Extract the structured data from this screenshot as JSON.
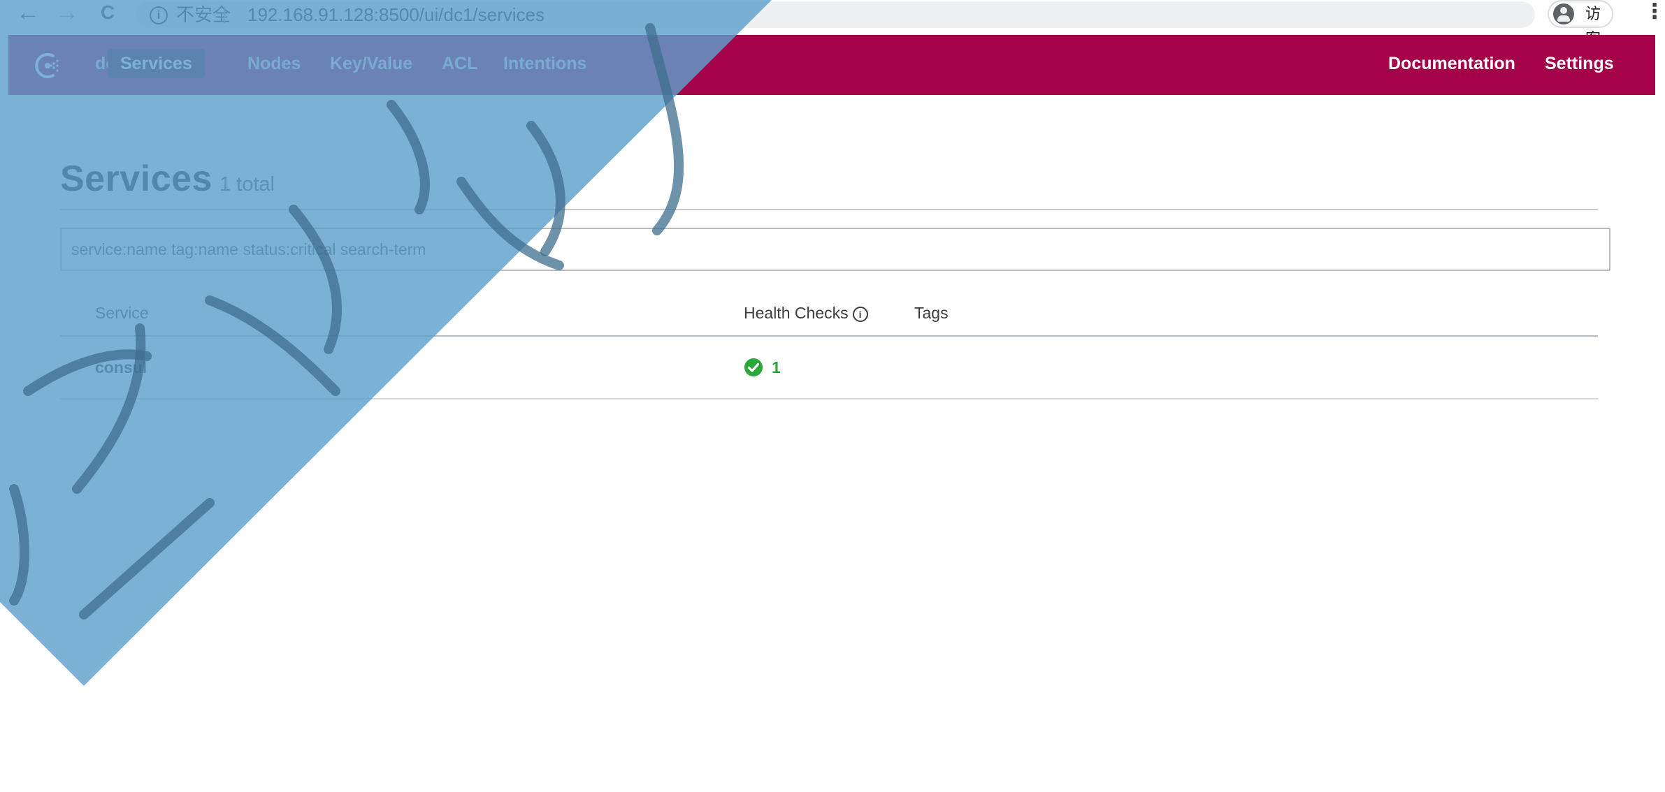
{
  "browser": {
    "back_glyph": "←",
    "forward_glyph": "→",
    "reload_glyph": "C",
    "insecure_label": "不安全",
    "url": "192.168.91.128:8500/ui/dc1/services",
    "profile_label": "访客",
    "more_glyph": "⋮"
  },
  "header": {
    "brand_icon": "consul-logo-icon",
    "accent_color": "#a4034a",
    "active_bg": "#56002b",
    "nav_items": [
      {
        "label": "dc1"
      },
      {
        "label": "Services",
        "active": true
      },
      {
        "label": "Nodes"
      },
      {
        "label": "Key/Value"
      },
      {
        "label": "ACL"
      },
      {
        "label": "Intentions"
      }
    ],
    "right_items": [
      {
        "label": "Documentation"
      },
      {
        "label": "Settings"
      }
    ]
  },
  "page": {
    "title": "Services",
    "total": "1 total",
    "search_value": "service:name tag:name status:critical search-term",
    "columns": {
      "service": "Service",
      "health_checks": "Health Checks",
      "health_info_glyph": "i",
      "tags": "Tags"
    },
    "rows": [
      {
        "service": "consul",
        "health_passing": "1",
        "status_icon": "check-circle-icon",
        "tags": ""
      }
    ],
    "status_color": "#2ba839"
  },
  "watermark": {
    "color": "#6aa7d0"
  }
}
